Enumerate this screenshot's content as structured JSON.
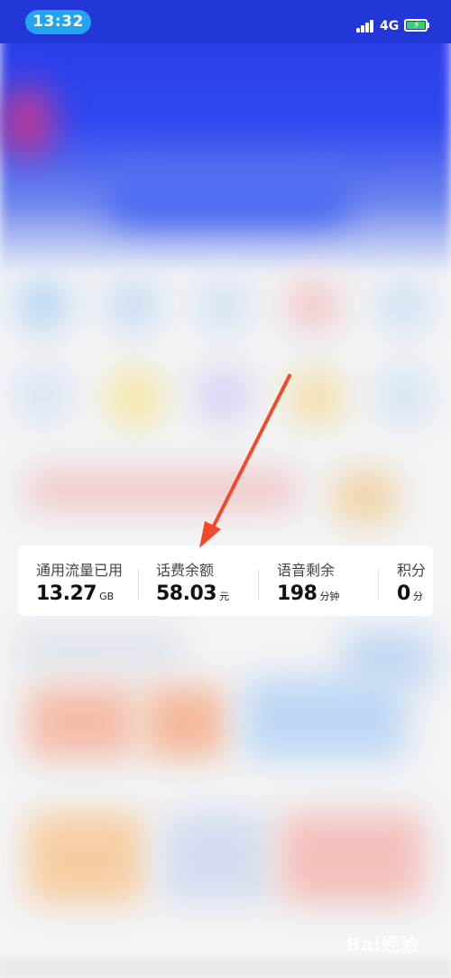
{
  "status_bar": {
    "time": "13:32",
    "network": "4G",
    "battery_charging": true
  },
  "stats": [
    {
      "label": "通用流量已用",
      "value": "13.27",
      "unit": "GB"
    },
    {
      "label": "话费余额",
      "value": "58.03",
      "unit": "元"
    },
    {
      "label": "语音剩余",
      "value": "198",
      "unit": "分钟"
    },
    {
      "label": "积分",
      "value": "0",
      "unit": "分"
    }
  ],
  "annotation": {
    "arrow_color": "#f04a2a"
  },
  "watermark": {
    "text": "Bai经验"
  },
  "colors": {
    "status_bar": "#2336d8",
    "time_pill": "#22a3f3",
    "battery": "#36d06e"
  }
}
